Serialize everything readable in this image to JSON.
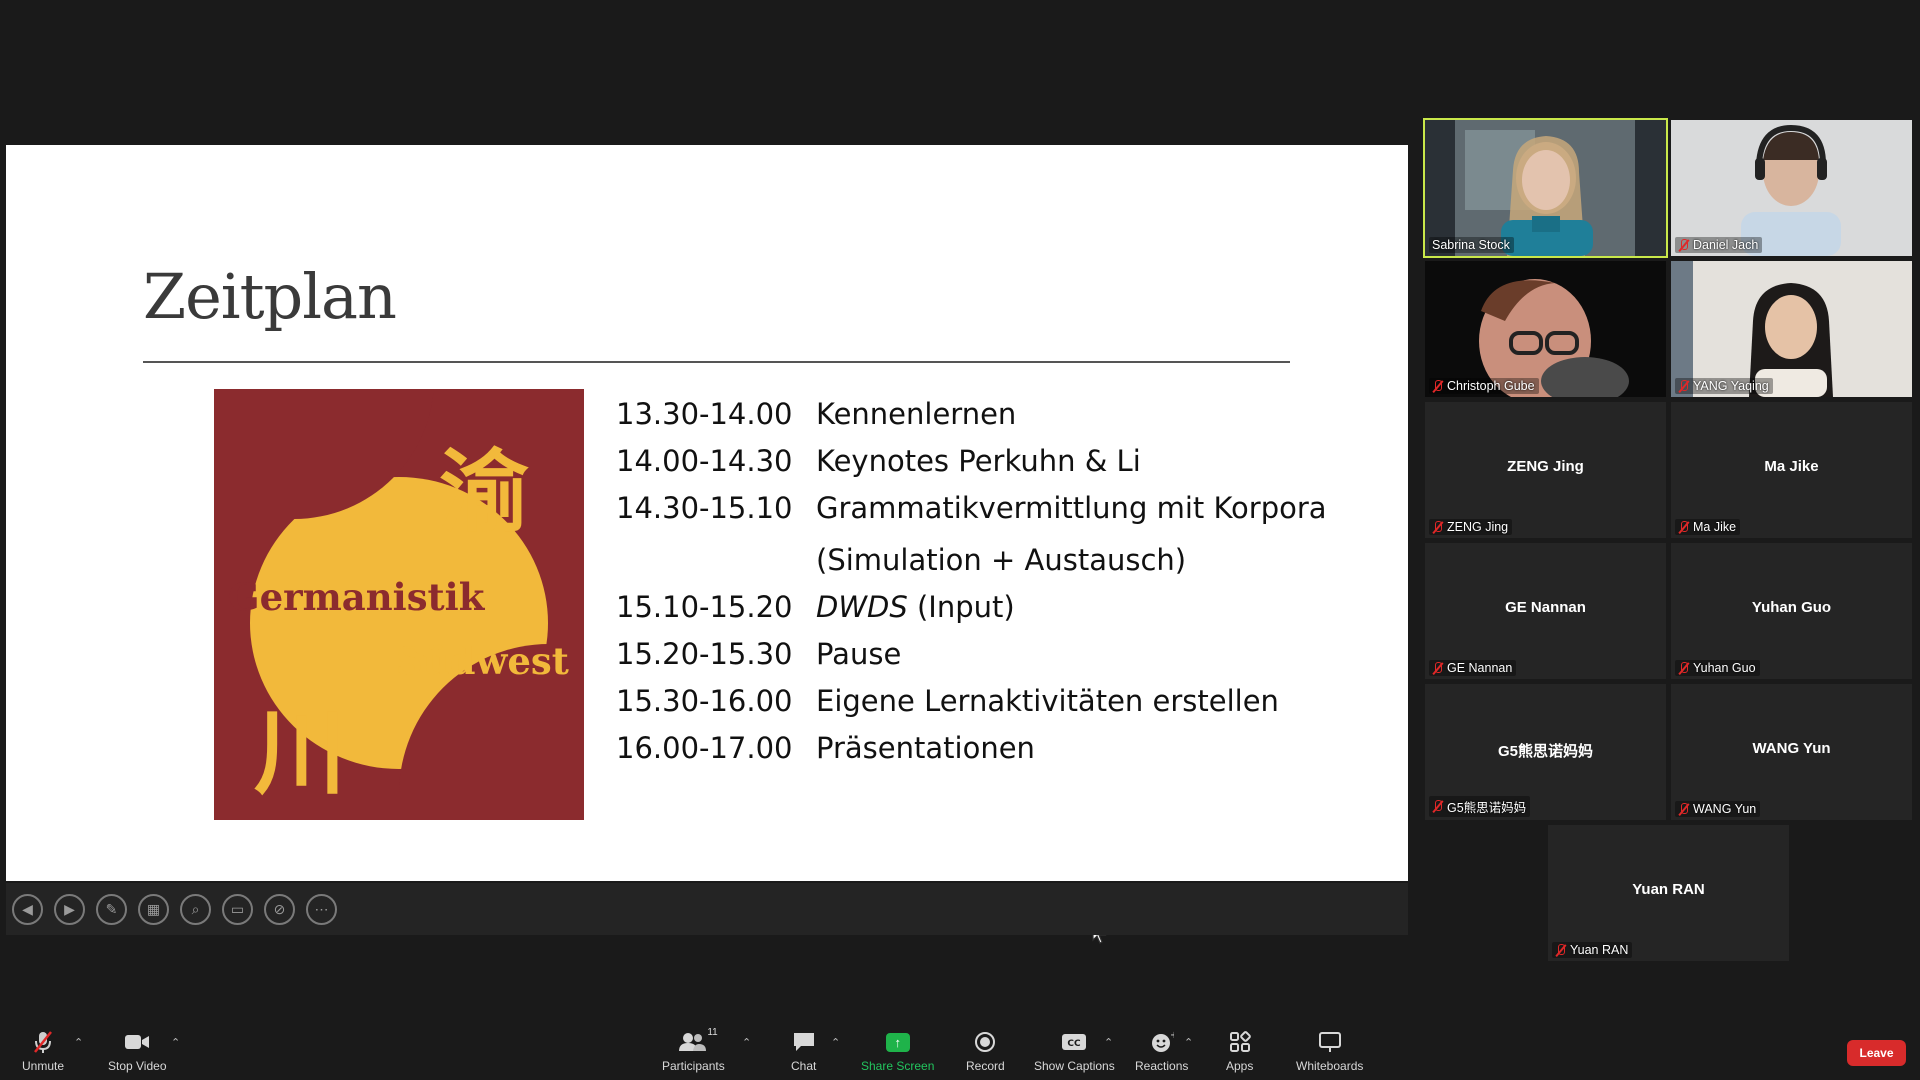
{
  "slide": {
    "title": "Zeitplan",
    "logo": {
      "char_top": "渝",
      "char_bottom": "川",
      "word1": "Germanistik",
      "word2": "Südwest",
      "colors": {
        "red": "#8b2b2e",
        "gold": "#f2b93b"
      }
    },
    "schedule": [
      {
        "time": "13.30-14.00",
        "activity": "Kennenlernen"
      },
      {
        "time": "14.00-14.30",
        "activity": "Keynotes Perkuhn & Li"
      },
      {
        "time": "14.30-15.10",
        "activity": "Grammatikvermittlung mit Korpora"
      },
      {
        "time": "",
        "activity": "(Simulation + Austausch)"
      },
      {
        "time": "15.10-15.20",
        "activity_italic": "DWDS",
        "activity_rest": " (Input)"
      },
      {
        "time": "15.20-15.30",
        "activity": "Pause"
      },
      {
        "time": "15.30-16.00",
        "activity": "Eigene Lernaktivitäten erstellen"
      },
      {
        "time": "16.00-17.00",
        "activity": "Präsentationen"
      }
    ]
  },
  "slide_controls": [
    "previous-icon",
    "next-icon",
    "pen-icon",
    "layout-icon",
    "zoom-icon",
    "subtitles-icon",
    "hide-video-icon",
    "more-icon"
  ],
  "participants": [
    {
      "name": "Sabrina Stock",
      "video": true,
      "active": true
    },
    {
      "name": "Daniel Jach",
      "video": true,
      "muted": true
    },
    {
      "name": "Christoph Gube",
      "video": true,
      "muted": true
    },
    {
      "name": "YANG Yaqing",
      "video": true,
      "muted": true
    },
    {
      "name": "ZENG Jing",
      "video": false,
      "muted": true
    },
    {
      "name": "Ma Jike",
      "video": false,
      "muted": true
    },
    {
      "name": "GE Nannan",
      "video": false,
      "muted": true
    },
    {
      "name": "Yuhan Guo",
      "video": false,
      "muted": true
    },
    {
      "name": "G5熊思诺妈妈",
      "video": false,
      "muted": true
    },
    {
      "name": "WANG Yun",
      "video": false,
      "muted": true
    },
    {
      "name": "Yuan RAN",
      "video": false,
      "muted": true
    }
  ],
  "toolbar": {
    "unmute": "Unmute",
    "stop_video": "Stop Video",
    "participants": "Participants",
    "participants_count": "11",
    "chat": "Chat",
    "share_screen": "Share Screen",
    "record": "Record",
    "show_captions": "Show Captions",
    "reactions": "Reactions",
    "apps": "Apps",
    "whiteboards": "Whiteboards",
    "leave": "Leave"
  },
  "colors": {
    "active_speaker": "#c9e84a",
    "share_green": "#1fb34a",
    "leave_red": "#d82b2b"
  }
}
